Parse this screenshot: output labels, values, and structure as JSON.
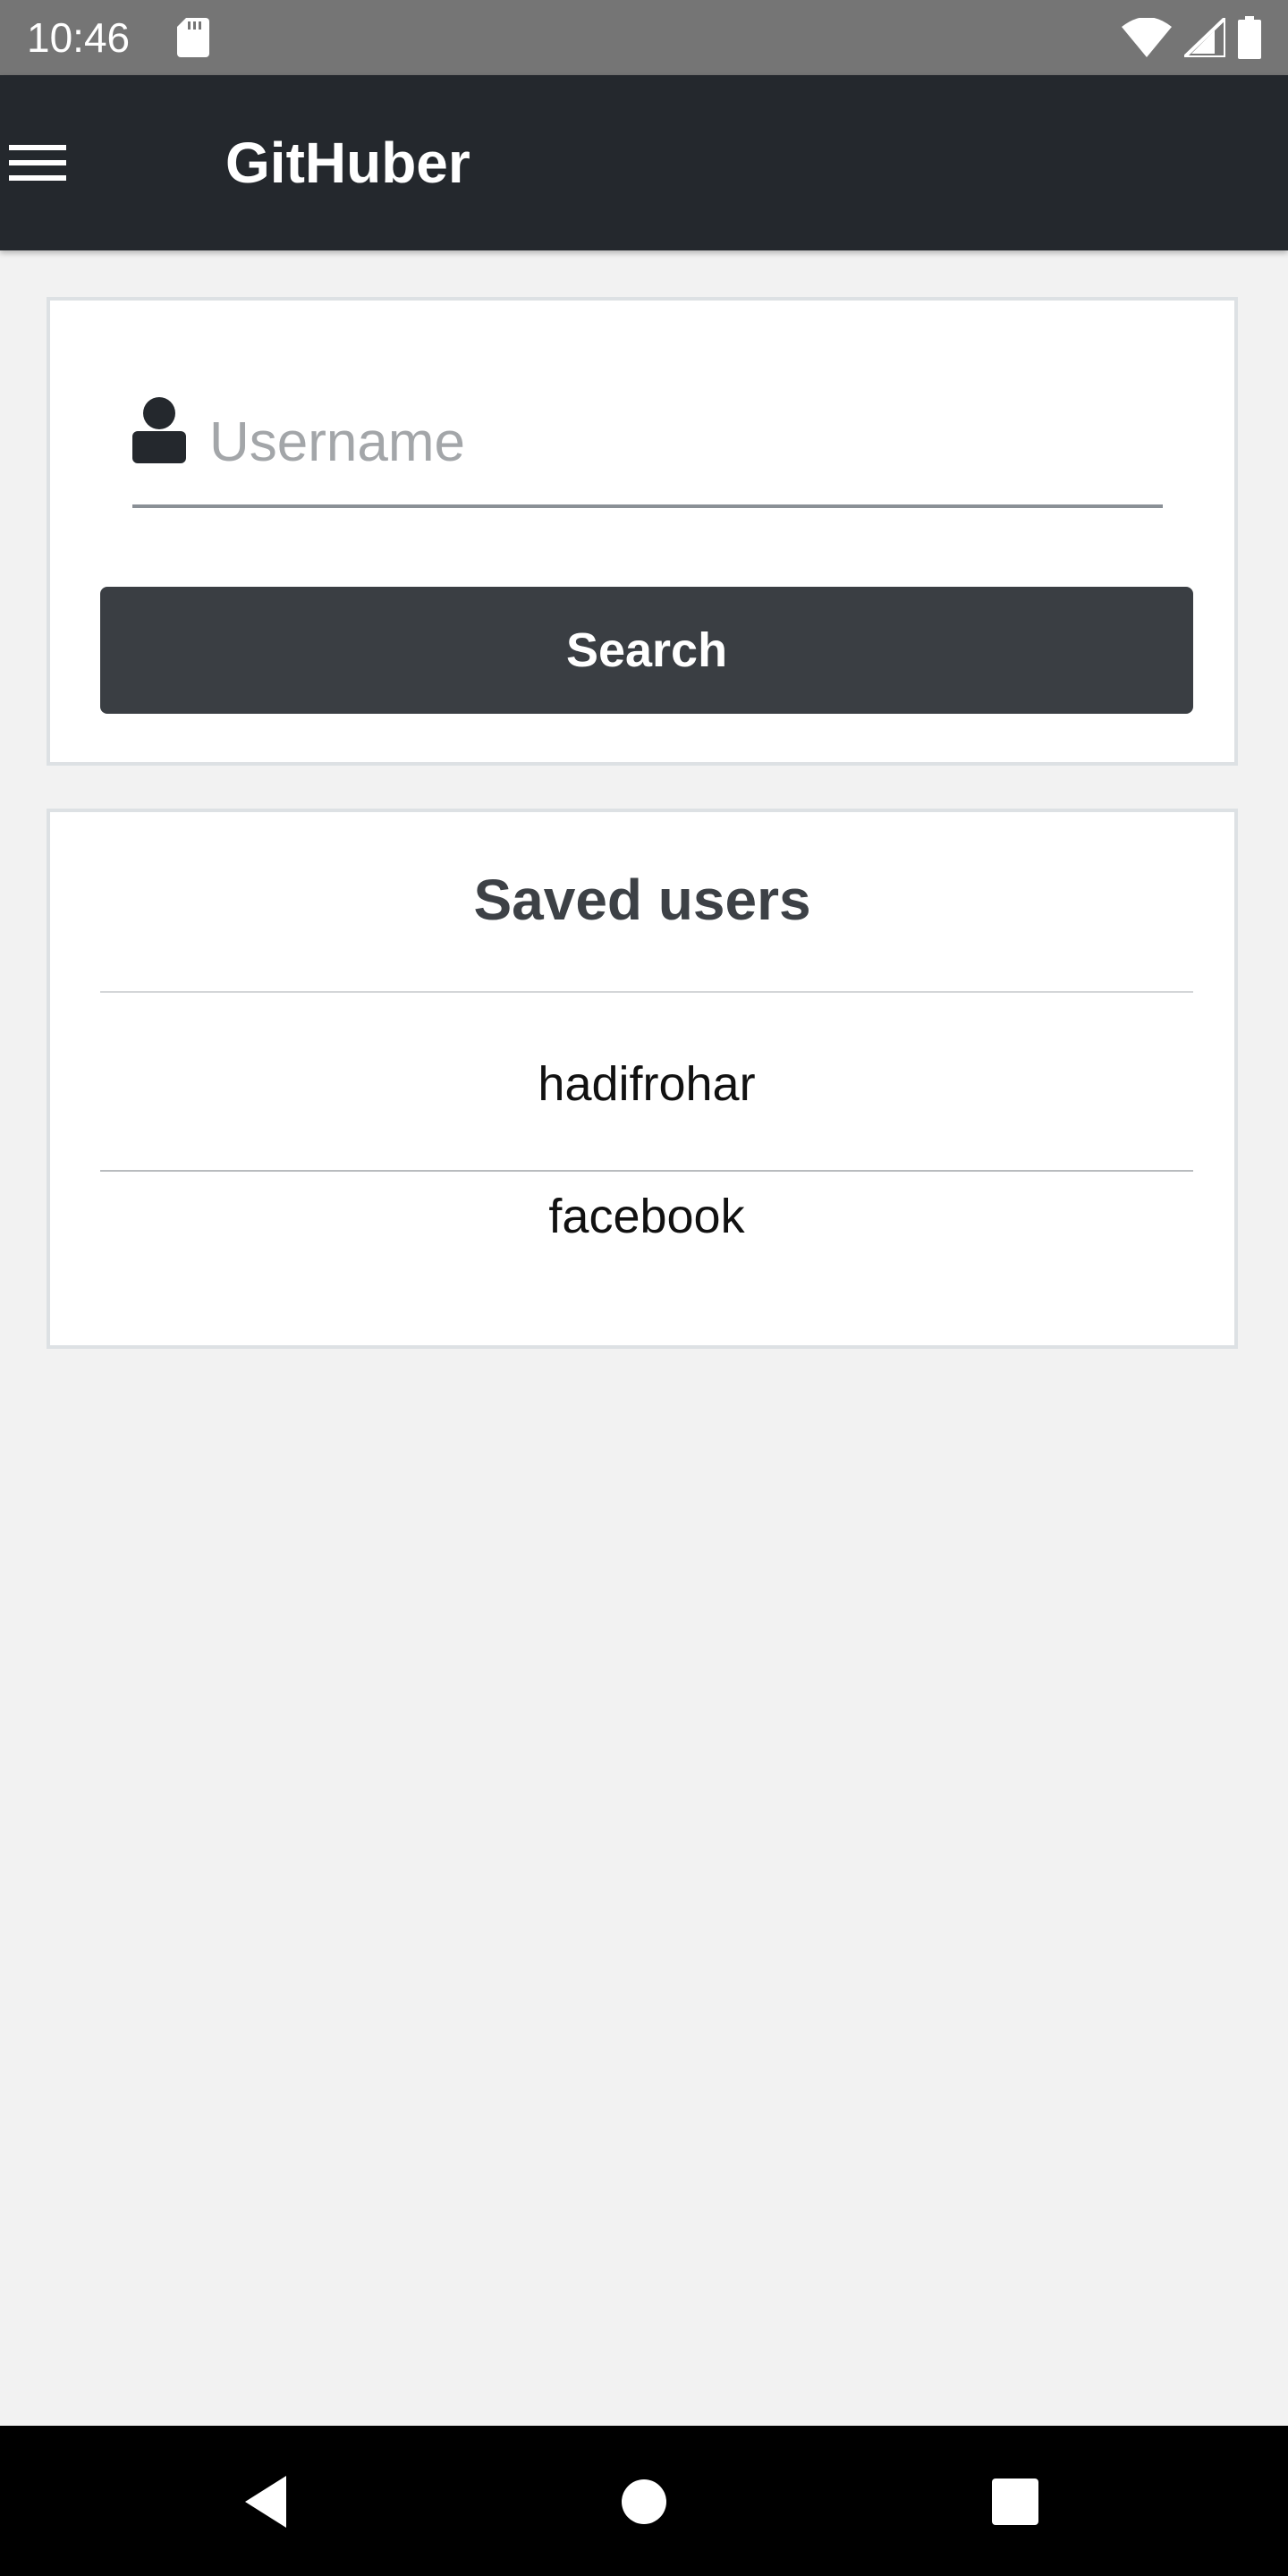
{
  "status_bar": {
    "time": "10:46",
    "icons": [
      "sd-card-icon",
      "wifi-icon",
      "cell-signal-icon",
      "battery-icon"
    ]
  },
  "app_bar": {
    "title": "GitHuber",
    "menu_icon": "hamburger-menu-icon"
  },
  "search": {
    "username_value": "",
    "username_placeholder": "Username",
    "user_icon": "user-icon",
    "button_label": "Search"
  },
  "saved_users": {
    "title": "Saved users",
    "items": [
      "hadifrohar",
      "facebook"
    ]
  },
  "nav_bar": {
    "icons": [
      "back-icon",
      "home-icon",
      "recents-icon"
    ]
  },
  "colors": {
    "app_bar": "#24282d",
    "status_bar": "#757575",
    "background": "#f2f2f2",
    "button": "#3a3e43",
    "card_border": "#dde1e4"
  }
}
